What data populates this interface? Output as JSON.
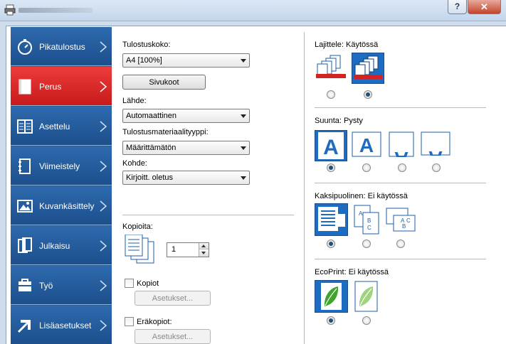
{
  "window": {
    "help_label": "?",
    "close_label": "✕"
  },
  "sidebar": {
    "items": [
      {
        "label": "Pikatulostus",
        "icon": "stopwatch-icon"
      },
      {
        "label": "Perus",
        "icon": "document-icon",
        "active": true
      },
      {
        "label": "Asettelu",
        "icon": "layout-icon"
      },
      {
        "label": "Viimeistely",
        "icon": "finishing-icon"
      },
      {
        "label": "Kuvankäsittely",
        "icon": "image-icon"
      },
      {
        "label": "Julkaisu",
        "icon": "publishing-icon"
      },
      {
        "label": "Työ",
        "icon": "job-icon"
      },
      {
        "label": "Lisäasetukset",
        "icon": "arrow-icon"
      }
    ],
    "colors": {
      "default": "#245b9a",
      "active": "#d42222"
    }
  },
  "left": {
    "print_size_label": "Tulostuskoko:",
    "print_size_value": "A4  [100%]",
    "page_sizes_button": "Sivukoot",
    "source_label": "Lähde:",
    "source_value": "Automaattinen",
    "media_type_label": "Tulostusmateriaalityyppi:",
    "media_type_value": "Määrittämätön",
    "destination_label": "Kohde:",
    "destination_value": "Kirjoitt. oletus",
    "copies_label": "Kopioita:",
    "copies_value": "1",
    "copies_checkbox_label": "Kopiot",
    "copies_settings_button": "Asetukset...",
    "batch_copies_label": "Eräkopiot:",
    "batch_settings_button": "Asetukset..."
  },
  "right": {
    "collate": {
      "label": "Lajittele:",
      "value": "Käytössä",
      "selected_index": 1,
      "tiles": [
        {
          "icon": "uncollated-icon"
        },
        {
          "icon": "collated-icon"
        }
      ]
    },
    "orientation": {
      "label": "Suunta:",
      "value": "Pysty",
      "selected_index": 0,
      "tiles": [
        {
          "icon": "portrait-icon"
        },
        {
          "icon": "landscape-icon"
        },
        {
          "icon": "portrait-rotated-icon"
        },
        {
          "icon": "landscape-rotated-icon"
        }
      ]
    },
    "duplex": {
      "label": "Kaksipuolinen:",
      "value": "Ei käytössä",
      "selected_index": 0,
      "tiles": [
        {
          "icon": "simplex-icon"
        },
        {
          "icon": "duplex-long-edge-icon"
        },
        {
          "icon": "duplex-short-edge-icon"
        }
      ]
    },
    "ecoprint": {
      "label": "EcoPrint:",
      "value": "Ei käytössä",
      "selected_index": 0,
      "tiles": [
        {
          "icon": "leaf-icon"
        },
        {
          "icon": "leaf-light-icon"
        }
      ]
    }
  }
}
